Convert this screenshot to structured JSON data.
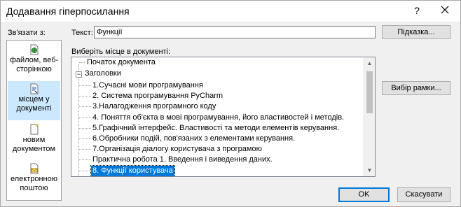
{
  "window": {
    "title": "Додавання гіперпосилання",
    "help_glyph": "?",
    "close_icon": "close-icon"
  },
  "link_to": {
    "label": "Зв'язати з:",
    "items": [
      {
        "label": "файлом, веб-сторінкою",
        "icon": "web-page-icon",
        "selected": false
      },
      {
        "label": "місцем у документі",
        "icon": "place-in-document-icon",
        "selected": true
      },
      {
        "label": "новим документом",
        "icon": "new-document-icon",
        "selected": false
      },
      {
        "label": "електронною поштою",
        "icon": "email-icon",
        "selected": false
      }
    ]
  },
  "text_to_display": {
    "label": "Текст:",
    "value": "Функції"
  },
  "buttons": {
    "screentip": "Підказка...",
    "bookmark": "Вибір рамки...",
    "ok": "OK",
    "cancel": "Скасувати"
  },
  "place": {
    "label": "Виберіть місце в документі:",
    "top_of_document": "Початок документа",
    "headings_label": "Заголовки",
    "headings_toggle": "−",
    "headings": [
      "1.Сучасні мови програмування",
      "2. Система програмування PyCharm",
      "3.Налагодження програмного коду",
      "4. Поняття об'єкта в мові програмування, його властивостей і методів.",
      "5.Графічний інтерфейс. Властивості та методи елементів керування.",
      "6.Обробники подій, пов'язаних з елементами керування.",
      "7.Організація діалогу користувача з програмою",
      "Практична робота 1.    Введення і виведення даних.",
      "8.  Функції користувача"
    ],
    "selected_index": 8
  },
  "scroll": {
    "up_glyph": "▲",
    "down_glyph": "▼"
  }
}
